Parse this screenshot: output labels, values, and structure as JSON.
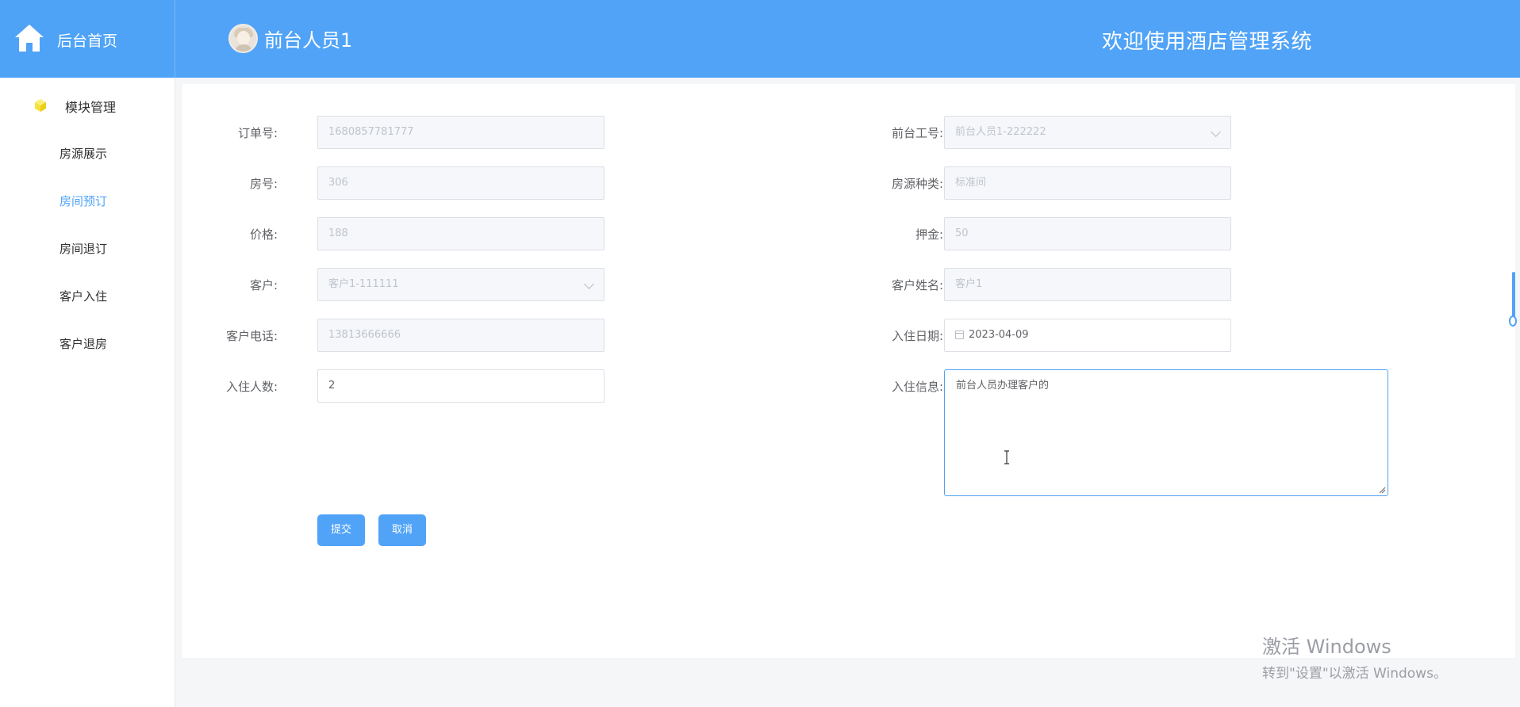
{
  "header": {
    "home_label": "后台首页",
    "user_name": "前台人员1",
    "welcome": "欢迎使用酒店管理系统"
  },
  "sidebar": {
    "group_label": "模块管理",
    "items": [
      {
        "label": "房源展示"
      },
      {
        "label": "房间预订",
        "active": true
      },
      {
        "label": "房间退订"
      },
      {
        "label": "客户入住"
      },
      {
        "label": "客户退房"
      }
    ]
  },
  "form": {
    "order_no": {
      "label": "订单号:",
      "value": "1680857781777"
    },
    "room_no": {
      "label": "房号:",
      "value": "306"
    },
    "price": {
      "label": "价格:",
      "value": "188"
    },
    "customer": {
      "label": "客户:",
      "value": "客户1-111111"
    },
    "customer_phone": {
      "label": "客户电话:",
      "value": "13813666666"
    },
    "guest_count": {
      "label": "入住人数:",
      "value": "2"
    },
    "staff_no": {
      "label": "前台工号:",
      "value": "前台人员1-222222"
    },
    "room_type": {
      "label": "房源种类:",
      "value": "标准间"
    },
    "deposit": {
      "label": "押金:",
      "value": "50"
    },
    "customer_name": {
      "label": "客户姓名:",
      "value": "客户1"
    },
    "checkin_date": {
      "label": "入住日期:",
      "value": "2023-04-09"
    },
    "checkin_info": {
      "label": "入住信息:",
      "value": "前台人员办理客户的"
    },
    "submit_label": "提交",
    "cancel_label": "取消"
  },
  "watermark": {
    "line1": "激活 Windows",
    "line2": "转到\"设置\"以激活 Windows。"
  },
  "colors": {
    "primary": "#50a3f7",
    "menu_active": "#50a3f7"
  }
}
